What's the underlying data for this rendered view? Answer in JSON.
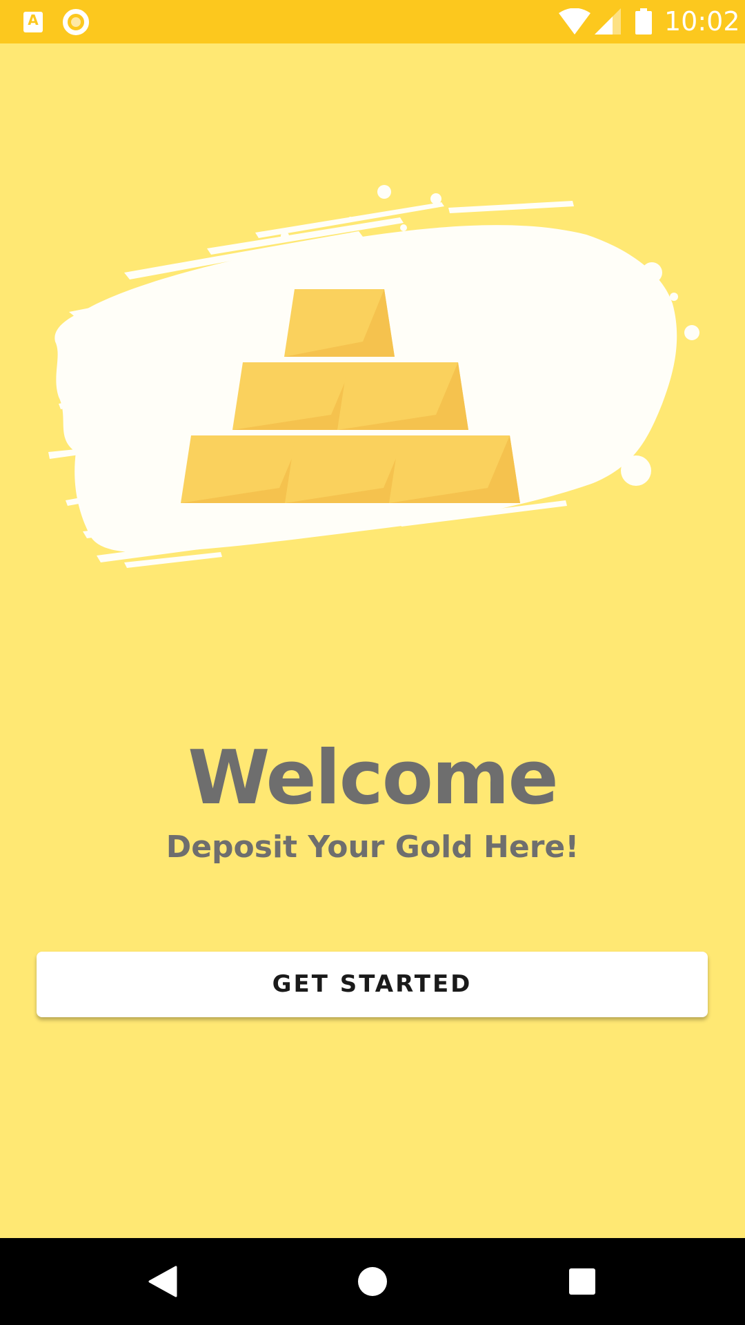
{
  "status_bar": {
    "time": "10:02",
    "app_badge_letter": "A",
    "background_color": "#FCC81E",
    "icons": [
      "a-app-icon",
      "ring-app-icon",
      "wifi-icon",
      "signal-icon",
      "battery-icon"
    ]
  },
  "welcome": {
    "title": "Welcome",
    "subtitle": "Deposit Your Gold Here!",
    "button_label": "GET STARTED"
  },
  "hero": {
    "illustration": "gold-bars-pyramid-illustration",
    "bar_count": 6
  },
  "nav_bar": {
    "icons": [
      "back-icon",
      "home-icon",
      "recents-icon"
    ]
  },
  "colors": {
    "background": "#FFE873",
    "status_bar": "#FCC81E",
    "text": "#6E6E6E",
    "button": "#FFFFFF",
    "gold_light": "#FAD15D",
    "gold_dark": "#F5C24E",
    "nav_bar": "#000000"
  }
}
